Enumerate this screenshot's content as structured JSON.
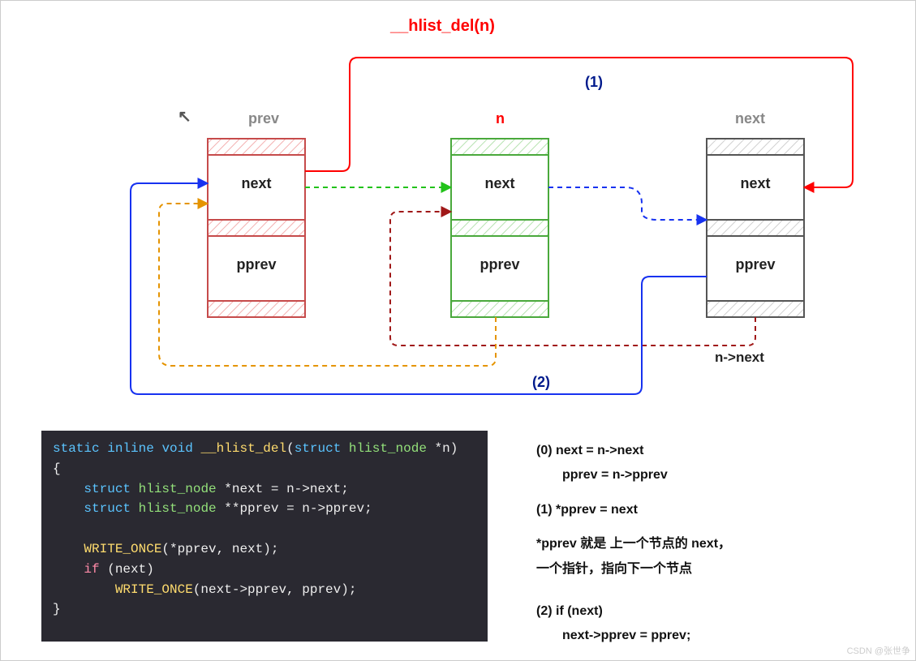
{
  "title": "__hlist_del(n)",
  "nodes": {
    "prev": {
      "label": "prev",
      "top": "next",
      "bottom": "pprev"
    },
    "n": {
      "label": "n",
      "top": "next",
      "bottom": "pprev"
    },
    "next": {
      "label": "next",
      "top": "next",
      "bottom": "pprev"
    }
  },
  "steps": {
    "s1": "(1)",
    "s2": "(2)"
  },
  "side": {
    "nnext": "n->next"
  },
  "code": {
    "l1a": "static",
    "l1b": "inline",
    "l1c": "void",
    "l1d": "__hlist_del",
    "l1e": "struct",
    "l1f": "hlist_node",
    "l1g": "*n",
    "l3a": "struct",
    "l3b": "hlist_node",
    "l3c": "*next = n->next;",
    "l4a": "struct",
    "l4b": "hlist_node",
    "l4c": "**pprev = n->pprev;",
    "l6a": "WRITE_ONCE",
    "l6b": "(*pprev, next);",
    "l7a": "if",
    "l7b": "(next)",
    "l8a": "WRITE_ONCE",
    "l8b": "(next->pprev, pprev);"
  },
  "notes": {
    "n0a": "(0) next = n->next",
    "n0b": "pprev = n->pprev",
    "n1": "(1)  *pprev = next",
    "n_exp1": "*pprev 就是 上一个节点的 next，",
    "n_exp2": "一个指针，指向下一个节点",
    "n2a": "(2)  if (next)",
    "n2b": "next->pprev = pprev;"
  },
  "watermark": "CSDN @张世争",
  "chart_data": {
    "type": "diagram",
    "description": "Linked list deletion of node n from doubly linked hlist",
    "nodes": [
      "prev",
      "n",
      "next"
    ],
    "arrows": [
      {
        "from": "prev.next",
        "to": "n.next",
        "style": "dashed",
        "color": "green",
        "meaning": "original forward link"
      },
      {
        "from": "n.next",
        "to": "next.next",
        "style": "dashed",
        "color": "blue",
        "meaning": "original forward link"
      },
      {
        "from": "n.pprev",
        "to": "prev.next",
        "style": "dashed",
        "color": "orange",
        "meaning": "original back link"
      },
      {
        "from": "next.pprev",
        "to": "n.next",
        "style": "dashed",
        "color": "darkred",
        "meaning": "original back link"
      },
      {
        "from": "prev.next",
        "to": "next.next",
        "style": "solid",
        "color": "red",
        "label": "(1)",
        "meaning": "*pprev = next"
      },
      {
        "from": "next.pprev",
        "to": "prev.next",
        "style": "solid",
        "color": "blue",
        "label": "(2)",
        "meaning": "next->pprev = pprev"
      }
    ]
  }
}
